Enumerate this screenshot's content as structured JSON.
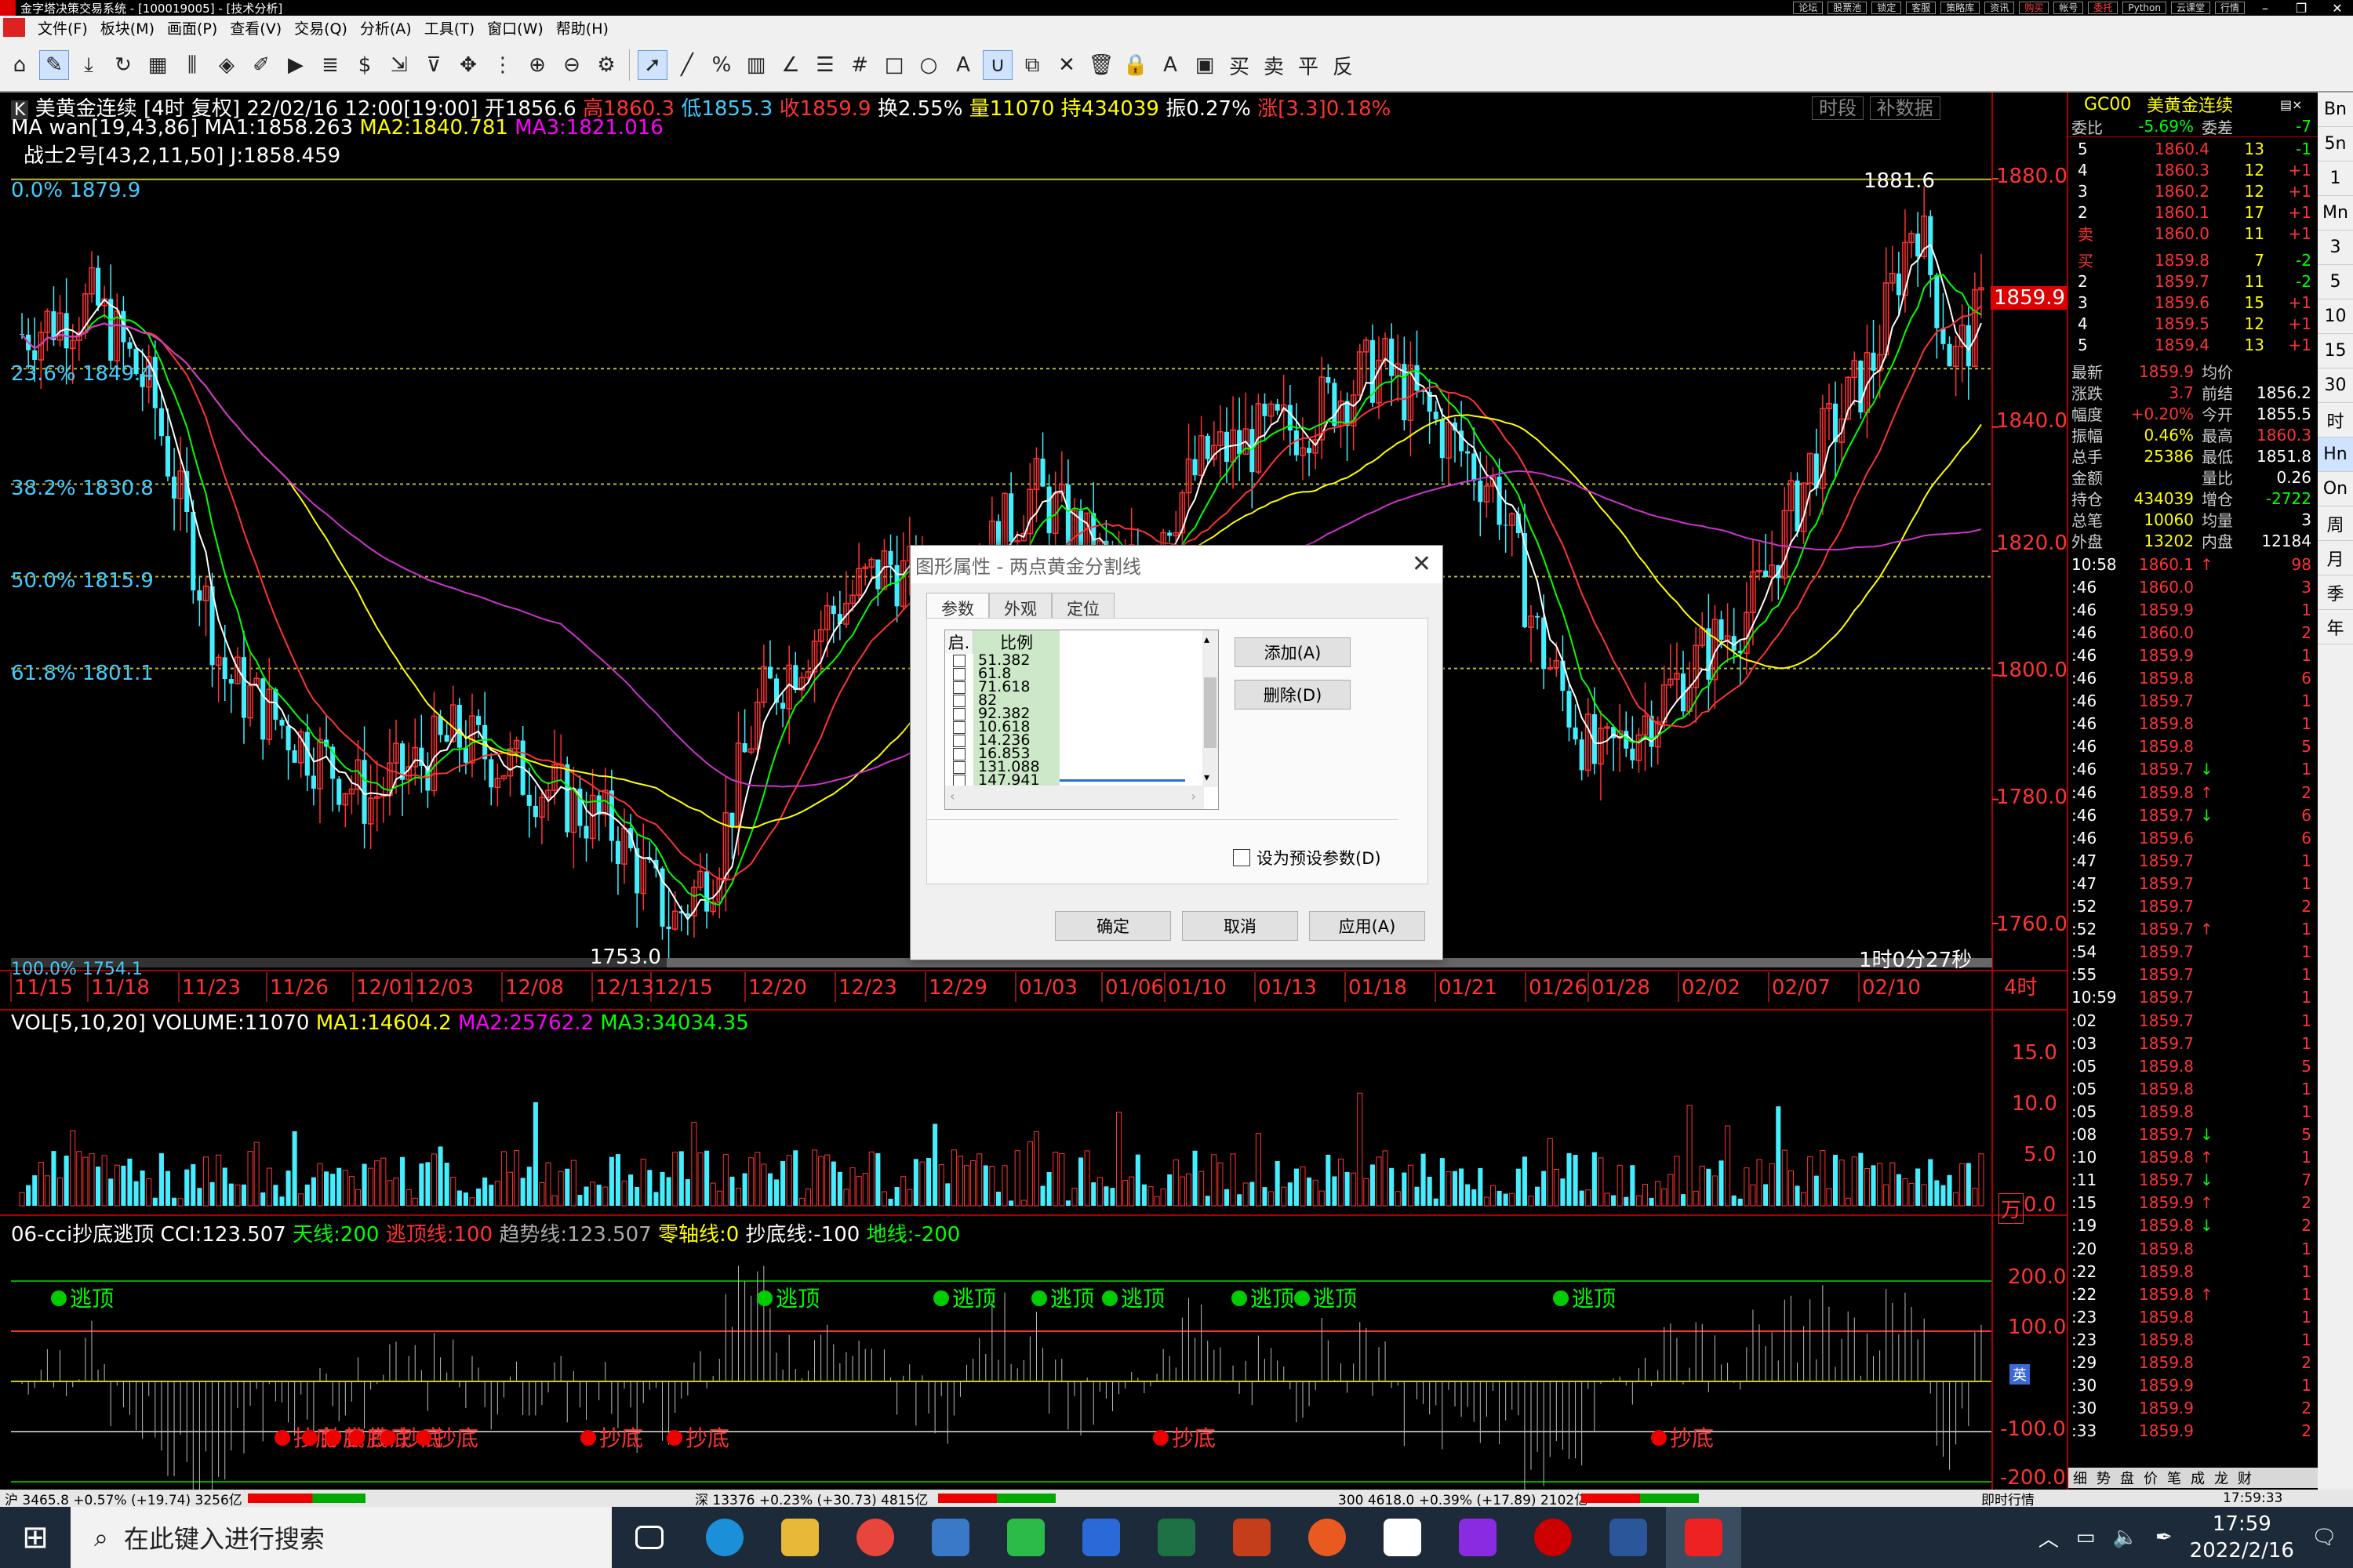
{
  "window": {
    "title": "金字塔决策交易系统 - [100019005] - [技术分析]",
    "top_buttons": [
      "论坛",
      "股票池",
      "锁定",
      "客服",
      "策略库",
      "资讯",
      "购买",
      "帐号",
      "委托",
      "Python",
      "云课堂",
      "行情"
    ]
  },
  "menu": [
    "文件(F)",
    "板块(M)",
    "画面(P)",
    "查看(V)",
    "交易(Q)",
    "分析(A)",
    "工具(T)",
    "窗口(W)",
    "帮助(H)"
  ],
  "toolbar_icons": [
    "home-icon",
    "pen-icon",
    "download-icon",
    "refresh-icon",
    "grid-icon",
    "bar-chart-icon",
    "diamond-icon",
    "edit-icon",
    "play-icon",
    "formula-icon",
    "dollar-icon",
    "export-icon",
    "filter-icon",
    "move-icon",
    "ruler-icon",
    "zoom-in-icon",
    "zoom-out-icon",
    "settings-icon",
    "pointer-icon",
    "line-icon",
    "percent-icon",
    "table-icon",
    "angle-icon",
    "list-icon",
    "hash-icon",
    "rect-icon",
    "circle-icon",
    "text-icon",
    "magnet-icon",
    "copy-icon",
    "close-icon",
    "trash-icon",
    "lock-icon",
    "color-icon",
    "save-icon",
    "buy-icon",
    "sell-icon",
    "flat-icon",
    "reverse-icon"
  ],
  "chart_header": {
    "symbol_line": {
      "name": "美黄金连续",
      "period": "[4时 复权]",
      "datetime": "22/02/16 12:00[19:00]",
      "open": "开1856.6",
      "high": "高1860.3",
      "low": "低1855.3",
      "close": "收1859.9",
      "turnover": "换2.55%",
      "volume": "量11070",
      "oi": "持434039",
      "amp": "振0.27%",
      "chg": "涨[3.3]0.18%"
    },
    "ma_line": {
      "name": "MA wan[19,43,86]",
      "ma1": "MA1:1858.263",
      "ma2": "MA2:1840.781",
      "ma3": "MA3:1821.016"
    },
    "j_line": "战士2号[43,2,11,50] J:1858.459",
    "tabs": [
      "时段",
      "补数据"
    ]
  },
  "fib_levels": [
    {
      "label": "0.0% 1879.9",
      "value": 1879.9
    },
    {
      "label": "23.6% 1849.4",
      "value": 1849.4
    },
    {
      "label": "38.2% 1830.8",
      "value": 1830.8
    },
    {
      "label": "50.0% 1815.9",
      "value": 1815.9
    },
    {
      "label": "61.8% 1801.1",
      "value": 1801.1
    },
    {
      "label": "100.0% 1754.1",
      "value": 1754.1
    }
  ],
  "price_axis": [
    "1880.0",
    "1840.0",
    "1820.0",
    "1800.0",
    "1780.0",
    "1760.0"
  ],
  "price_marks": {
    "high": "1881.6",
    "low": "1753.0",
    "last": "1859.9",
    "countdown": "1时0分27秒"
  },
  "date_axis": [
    "11/15",
    "11/18",
    "11/23",
    "11/26",
    "12/01",
    "12/03",
    "12/08",
    "12/13",
    "12/15",
    "12/20",
    "12/23",
    "12/29",
    "01/03",
    "01/06",
    "01/10",
    "01/13",
    "01/18",
    "01/21",
    "01/26",
    "01/28",
    "02/02",
    "02/07",
    "02/10"
  ],
  "period_label": "4时",
  "volume_panel": {
    "name": "VOL[5,10,20] VOLUME:11070",
    "ma1": "MA1:14604.2",
    "ma2": "MA2:25762.2",
    "ma3": "MA3:34034.35",
    "axis": [
      "15.0",
      "10.0",
      "5.0",
      "0.0"
    ],
    "unit": "万"
  },
  "cci_panel": {
    "name": "06-cci抄底逃顶 CCI:123.507",
    "sky": "天线:200",
    "escape": "逃顶线:100",
    "trend": "趋势线:123.507",
    "zero": "零轴线:0",
    "bottom": "抄底线:-100",
    "ground": "地线:-200",
    "axis": [
      "200.0",
      "100.0",
      "-100.0",
      "-200.0"
    ],
    "escape_label": "逃顶",
    "bottom_label": "抄底"
  },
  "dialog": {
    "title": "图形属性 - 两点黄金分割线",
    "tabs": [
      "参数",
      "外观",
      "定位"
    ],
    "col_enable": "启.",
    "col_ratio": "比例",
    "ratios": [
      "51.382",
      "61.8",
      "71.618",
      "82",
      "92.382",
      "10.618",
      "14.236",
      "16.853",
      "131.088",
      "147.941"
    ],
    "add": "添加(A)",
    "delete": "删除(D)",
    "preset": "设为预设参数(D)",
    "ok": "确定",
    "cancel": "取消",
    "apply": "应用(A)"
  },
  "quote": {
    "code": "GC00",
    "name": "美黄金连续",
    "wei_bi_label": "委比",
    "wei_bi": "-5.69%",
    "wei_cha_label": "委差",
    "wei_cha": "-7",
    "asks": [
      {
        "lv": "5",
        "price": "1860.4",
        "vol": "13",
        "chg": "-1"
      },
      {
        "lv": "4",
        "price": "1860.3",
        "vol": "12",
        "chg": "+1"
      },
      {
        "lv": "3",
        "price": "1860.2",
        "vol": "12",
        "chg": "+1"
      },
      {
        "lv": "2",
        "price": "1860.1",
        "vol": "17",
        "chg": "+1"
      },
      {
        "lv": "卖",
        "price": "1860.0",
        "vol": "11",
        "chg": "+1"
      }
    ],
    "bids": [
      {
        "lv": "买",
        "price": "1859.8",
        "vol": "7",
        "chg": "-2"
      },
      {
        "lv": "2",
        "price": "1859.7",
        "vol": "11",
        "chg": "-2"
      },
      {
        "lv": "3",
        "price": "1859.6",
        "vol": "15",
        "chg": "+1"
      },
      {
        "lv": "4",
        "price": "1859.5",
        "vol": "12",
        "chg": "+1"
      },
      {
        "lv": "5",
        "price": "1859.4",
        "vol": "13",
        "chg": "+1"
      }
    ],
    "stats": [
      [
        "最新",
        "1859.9",
        "均价",
        ""
      ],
      [
        "涨跌",
        "3.7",
        "前结",
        "1856.2"
      ],
      [
        "幅度",
        "+0.20%",
        "今开",
        "1855.5"
      ],
      [
        "振幅",
        "0.46%",
        "最高",
        "1860.3"
      ],
      [
        "总手",
        "25386",
        "最低",
        "1851.8"
      ],
      [
        "金额",
        "",
        "量比",
        "0.26"
      ],
      [
        "持仓",
        "434039",
        "增仓",
        "-2722"
      ],
      [
        "总笔",
        "10060",
        "均量",
        "3"
      ],
      [
        "外盘",
        "13202",
        "内盘",
        "12184"
      ]
    ],
    "ticks": [
      [
        "10:58",
        "1860.1",
        "↑",
        "98"
      ],
      [
        ":46",
        "1860.0",
        "",
        "3"
      ],
      [
        ":46",
        "1859.9",
        "",
        "1"
      ],
      [
        ":46",
        "1860.0",
        "",
        "2"
      ],
      [
        ":46",
        "1859.9",
        "",
        "1"
      ],
      [
        ":46",
        "1859.8",
        "",
        "6"
      ],
      [
        ":46",
        "1859.7",
        "",
        "1"
      ],
      [
        ":46",
        "1859.8",
        "",
        "1"
      ],
      [
        ":46",
        "1859.8",
        "",
        "5"
      ],
      [
        ":46",
        "1859.7",
        "↓",
        "1"
      ],
      [
        ":46",
        "1859.8",
        "↑",
        "2"
      ],
      [
        ":46",
        "1859.7",
        "↓",
        "6"
      ],
      [
        ":46",
        "1859.6",
        "",
        "6"
      ],
      [
        ":47",
        "1859.7",
        "",
        "1"
      ],
      [
        ":47",
        "1859.7",
        "",
        "1"
      ],
      [
        ":52",
        "1859.7",
        "",
        "2"
      ],
      [
        ":52",
        "1859.7",
        "↑",
        "1"
      ],
      [
        ":54",
        "1859.7",
        "",
        "1"
      ],
      [
        ":55",
        "1859.7",
        "",
        "1"
      ],
      [
        "10:59",
        "1859.7",
        "",
        "1"
      ],
      [
        ":02",
        "1859.7",
        "",
        "1"
      ],
      [
        ":03",
        "1859.7",
        "",
        "1"
      ],
      [
        ":05",
        "1859.8",
        "",
        "5"
      ],
      [
        ":05",
        "1859.8",
        "",
        "1"
      ],
      [
        ":05",
        "1859.8",
        "",
        "1"
      ],
      [
        ":08",
        "1859.7",
        "↓",
        "5"
      ],
      [
        ":10",
        "1859.8",
        "↑",
        "1"
      ],
      [
        ":11",
        "1859.7",
        "↓",
        "7"
      ],
      [
        ":15",
        "1859.9",
        "↑",
        "2"
      ],
      [
        ":19",
        "1859.8",
        "↓",
        "2"
      ],
      [
        ":20",
        "1859.8",
        "",
        "1"
      ],
      [
        ":22",
        "1859.8",
        "",
        "1"
      ],
      [
        ":22",
        "1859.8",
        "↑",
        "1"
      ],
      [
        ":23",
        "1859.8",
        "",
        "1"
      ],
      [
        ":23",
        "1859.8",
        "",
        "1"
      ],
      [
        ":29",
        "1859.8",
        "",
        "2"
      ],
      [
        ":30",
        "1859.9",
        "",
        "1"
      ],
      [
        ":30",
        "1859.9",
        "",
        "2"
      ],
      [
        ":33",
        "1859.9",
        "",
        "2"
      ]
    ],
    "bottom_tabs": [
      "细",
      "势",
      "盘",
      "价",
      "笔",
      "成",
      "龙",
      "财"
    ]
  },
  "side_tabs": [
    "Bn",
    "5n",
    "1",
    "Mn",
    "3",
    "5",
    "10",
    "15",
    "30",
    "时",
    "Hn",
    "On",
    "周",
    "月",
    "季",
    "年"
  ],
  "statusbar": {
    "sh": "沪 3465.8 +0.57% (+19.74) 3256亿",
    "sz": "深 13376 +0.23% (+30.73) 4815亿",
    "hs300": "300 4618.0 +0.39% (+17.89) 2102亿",
    "right": "即时行情",
    "time": "17:59:33"
  },
  "taskbar": {
    "search_placeholder": "在此键入进行搜索",
    "time": "17:59",
    "date": "2022/2/16"
  }
}
